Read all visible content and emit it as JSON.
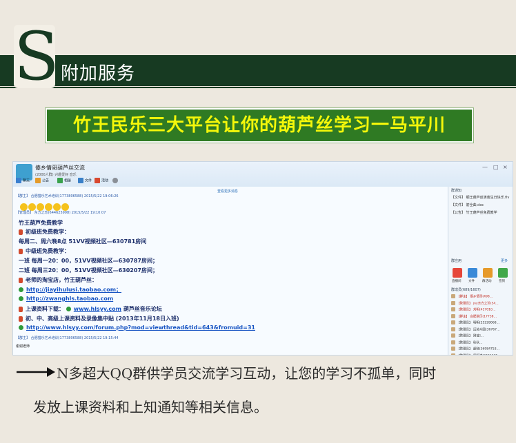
{
  "header": {
    "letter": "S",
    "title": "附加服务"
  },
  "subtitle": "竹王民乐三大平台让你的葫芦丝学习一马平川",
  "screenshot": {
    "group_name": "傣乡情哥葫芦丝交流",
    "group_sub": "(2000人群) 兴趣爱好 音乐",
    "window_controls": [
      "—",
      "□",
      "×"
    ],
    "toolbar": [
      "聊天",
      "公告",
      "相册",
      "文件",
      "活动",
      "设置"
    ],
    "more_messages": "查看更多消息",
    "messages": [
      {
        "header": "【群主】 合肥猎乐艺术培训(1773806588) 2015/5/22 19:06:26"
      },
      {
        "header": "【管理员】 东方之珍(644625998) 2015/5/22 19:10:07"
      },
      {
        "header": "【群主】 合肥猎乐艺术培训(1773806588) 2015/5/22 19:15:44"
      }
    ],
    "content_lines": [
      "竹王葫芦免费教学",
      "初级班免费教学：",
      "每周二、周六晚8点 51VV视频社区—630781房间",
      "中级班免费教学：",
      "一班 每周一20：00，51VV视频社区—630787房间；",
      "二班 每周三20：00，51VV视频社区—630207房间；",
      "老师的淘宝店，竹王葫芦丝：",
      "http://jiayihulusi.taobao.com；",
      "http://zwanghls.taobao.com",
      "上课资料下载：",
      "www.hlsyy.com",
      "葫芦丝音乐论坛",
      "初、中、高级上课资料及录像集中贴 (2013年11月18日入班)",
      "http://www.hlsyy.com/forum.php?mod=viewthread&tid=643&fromuid=31",
      "谢谢老师"
    ],
    "right_panel": {
      "notice_title": "群通知",
      "notices": [
        "【文件】 纲王葫芦丝演奏生日快乐.flv",
        "【文件】 箭全曲.doc",
        "【公告】 竹王葫芦丝免费教学"
      ],
      "apps_title": "群应用",
      "apps_more": "更多",
      "apps": [
        "直播间",
        "文件",
        "群活动",
        "签到"
      ],
      "members_title": "群成员(689/1607)",
      "members": [
        "【群主】 傣乡情哥(498…",
        "【管理员】 jny东方之珍(54…",
        "【管理员】 刘明(417010…",
        "【群主】 合肥猎乐(17738…",
        "【管理员】 明明(25228068…",
        "【管理员】 迈装众圆(36767…",
        "【管理员】 刚芸]…",
        "【管理员】 秋秋…",
        "【管理员】 超晓(36984753…",
        "【管理员】 康熙满(3404135…",
        "【管理员】 西子(45410667…",
        "【管理员】 小月(1396405…",
        "【管理员】 高静(11590486…",
        "【管理员】 海明(495685783…",
        "【管理员】 龙女(4034458…",
        "【管理员】 小叶子(178…",
        "【管理员】 竹王葫芦丝原创…"
      ]
    }
  },
  "bottom": {
    "line1": "N多超大QQ群供学员交流学习互动，让您的学习不孤单，同时",
    "line2": "发放上课资料和上知通知等相关信息。"
  },
  "colors": {
    "banner": "#173a22",
    "subtitle_bg": "#2f7a23",
    "subtitle_text": "#f4f70a",
    "page_bg": "#ede8df"
  }
}
